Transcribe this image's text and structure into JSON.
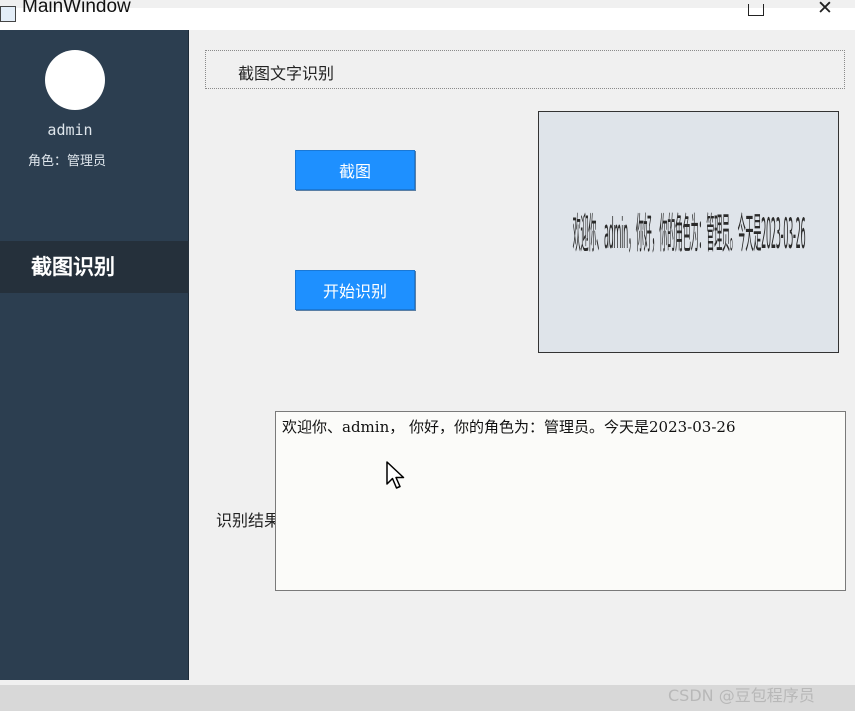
{
  "window": {
    "title": "MainWindow",
    "icons": [
      "app-icon",
      "maximize-icon",
      "close-icon"
    ],
    "close_glyph": "✕"
  },
  "sidebar": {
    "username": "admin",
    "role": "角色：管理员",
    "nav_item": "截图识别",
    "colors": {
      "background": "#2c3e50",
      "active_item": "#25303b"
    }
  },
  "main": {
    "header": "截图文字识别",
    "screenshot_button": "截图",
    "recognize_button": "开始识别",
    "preview_text": "欢迎你、admin，你好，你的角色为：管理员。今天是2023-03-26",
    "result_label": "识别结果",
    "result_text": "欢迎你、admin， 你好，你的角色为：管理员。今天是2023-03-26",
    "colors": {
      "button": "#1e90ff"
    }
  },
  "watermark": "CSDN @豆包程序员"
}
